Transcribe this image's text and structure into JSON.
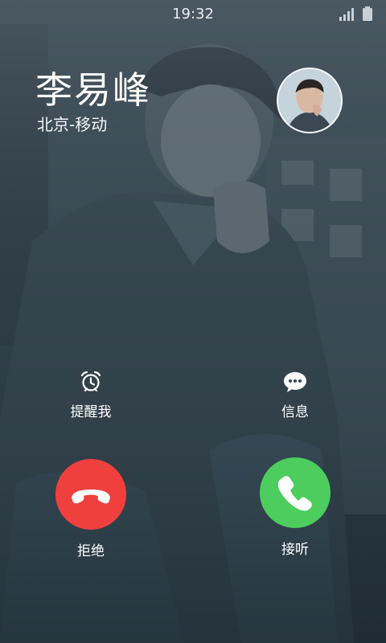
{
  "status_bar": {
    "time": "19:32",
    "icons": [
      "signal-icon",
      "battery-icon"
    ]
  },
  "caller": {
    "name": "李易峰",
    "location": "北京-移动"
  },
  "actions": {
    "remind_label": "提醒我",
    "message_label": "信息",
    "decline_label": "拒绝",
    "accept_label": "接听"
  },
  "colors": {
    "decline": "#f0403e",
    "accept": "#4ccd5d",
    "background": "#33434d"
  }
}
